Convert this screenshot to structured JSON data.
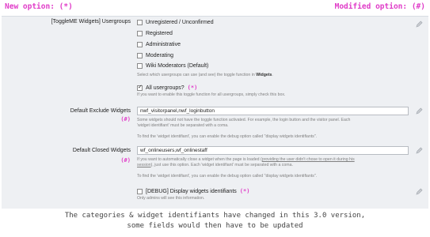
{
  "header": {
    "new_option": "New option: (*)",
    "modified_option": "Modified option: (#)"
  },
  "usergroups": {
    "label": "[ToggleME Widgets] Usergroups",
    "items": [
      {
        "label": "Unregistered / Unconfirmed",
        "checked": false
      },
      {
        "label": "Registered",
        "checked": false
      },
      {
        "label": "Administrative",
        "checked": false
      },
      {
        "label": "Moderating",
        "checked": false
      },
      {
        "label": "Wiki Moderators (Default)",
        "checked": false
      }
    ],
    "hint_pre": "Select which usergroups can use (and see) the toggle function in ",
    "hint_bold": "Widgets",
    "hint_post": ".",
    "all_label": "All usergroups?",
    "all_checked": true,
    "all_mark": "(*)",
    "all_hint": "If you want to enable this toggle function for all usergroups, simply check this box."
  },
  "exclude": {
    "label": "Default Exclude Widgets",
    "mark": "(#)",
    "value": "nwf_visitorpanel,nwf_loginbutton",
    "hint1": "Some widgets should not have the toggle function activated. For example, the login button and the visitor panel. Each",
    "hint2": "'widget identifiant' must be separated with a coma.",
    "hint3": "To find the 'widget identifiant', you can enable the debug option called \"display widgets identifiants\"."
  },
  "closed": {
    "label": "Default Closed Widgets",
    "mark": "(#)",
    "value": "wf_onlineusers,wf_onlinestaff",
    "hint1_pre": "If you want to automatically close a widget when the page is loaded (",
    "hint1_link": "providing the user didn't chose to open it during his",
    "hint2_link": "session",
    "hint2_post": "), just use this option. Each 'widget identifiant' must be separated with a coma.",
    "hint3": "To find the 'widget identifiant', you can enable the debug option called \"display widgets identifiants\"."
  },
  "debug": {
    "label": "[DEBUG] Display widgets identifiants",
    "checked": false,
    "mark": "(*)",
    "hint": "Only admins will see this information."
  },
  "footer": {
    "line1": "The categories & widget identifiants have changed in this 3.0 version,",
    "line2": "some fields would then have to be updated"
  },
  "colors": {
    "accent": "#e03cc8",
    "panel": "#eef0f3"
  },
  "icons": [
    "pencil-icon"
  ]
}
